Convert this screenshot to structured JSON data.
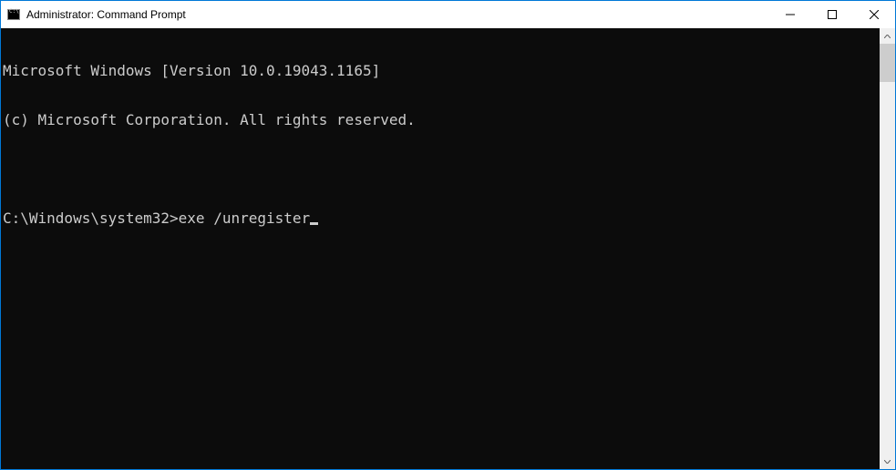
{
  "titlebar": {
    "title": "Administrator: Command Prompt"
  },
  "console": {
    "line1": "Microsoft Windows [Version 10.0.19043.1165]",
    "line2": "(c) Microsoft Corporation. All rights reserved.",
    "prompt": "C:\\Windows\\system32>",
    "command": "exe /unregister"
  }
}
